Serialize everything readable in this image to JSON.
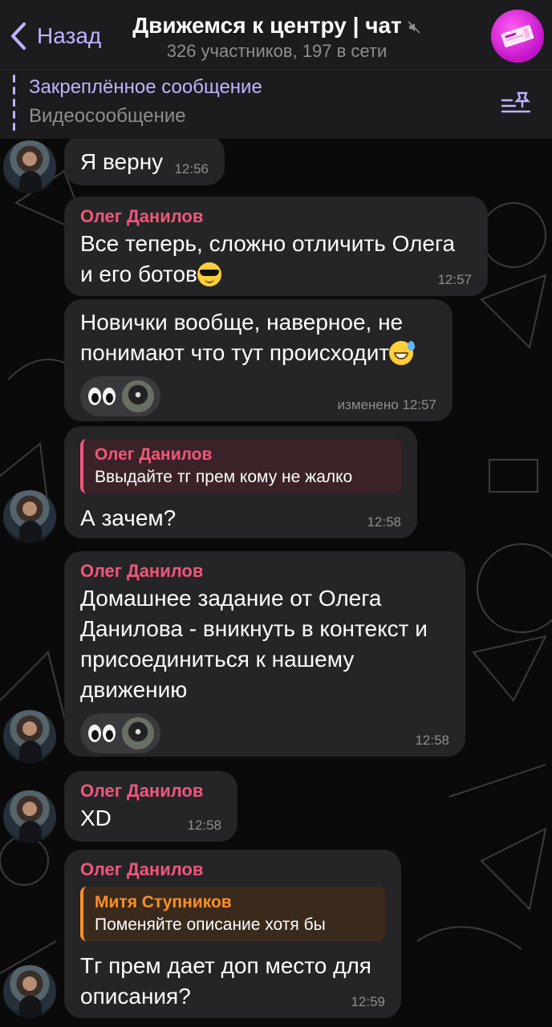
{
  "header": {
    "back_label": "Назад",
    "title": "Движемся к центру | чат",
    "subtitle": "326 участников, 197 в сети",
    "accent_color": "#c1b2ff"
  },
  "pinned": {
    "title": "Закреплённое сообщение",
    "text": "Видеосообщение"
  },
  "messages": [
    {
      "sender": "",
      "text": "Я верну",
      "time": "12:56"
    },
    {
      "sender": "Олег Данилов",
      "text": "Все теперь, сложно отличить Олега и его ботов",
      "emoji": "smiling-face-with-sunglasses",
      "time": "12:57"
    },
    {
      "sender": "",
      "text": "Новички вообще, наверное, не понимают что тут происходит",
      "emoji": "grinning-face-with-sweat",
      "reaction": "eyes",
      "time": "изменено 12:57"
    },
    {
      "sender": "",
      "reply_name": "Олег Данилов",
      "reply_text": "Ввыдайте тг прем кому не жалко",
      "text": "А зачем?",
      "time": "12:58"
    },
    {
      "sender": "Олег Данилов",
      "text": "Домашнее задание от Олега Данилова - вникнуть в контекст и присоединиться к нашему движению",
      "reaction": "eyes",
      "time": "12:58"
    },
    {
      "sender": "Олег Данилов",
      "text": "XD",
      "time": "12:58"
    },
    {
      "sender": "Олег Данилов",
      "reply_name": "Митя Ступников",
      "reply_text": "Поменяйте описание хотя бы",
      "text": "Тг прем дает доп место для описания?",
      "time": "12:59"
    }
  ]
}
